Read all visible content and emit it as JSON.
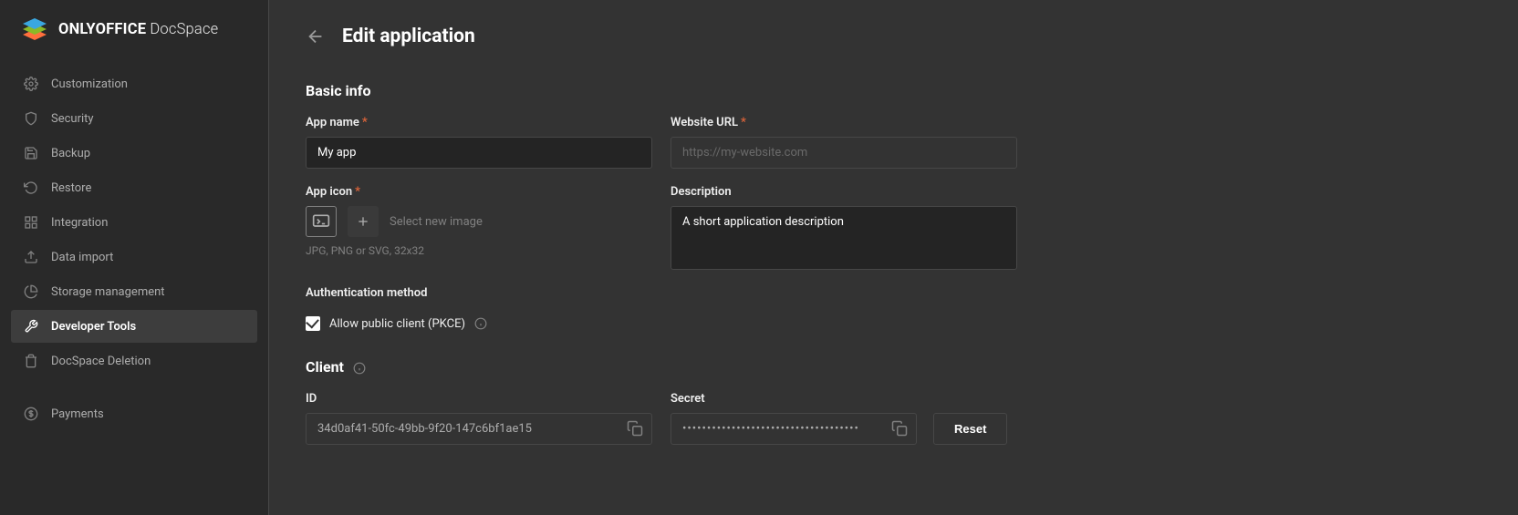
{
  "brand": {
    "bold": "ONLYOFFICE",
    "light": " DocSpace"
  },
  "sidebar": {
    "items": [
      {
        "label": "Customization"
      },
      {
        "label": "Security"
      },
      {
        "label": "Backup"
      },
      {
        "label": "Restore"
      },
      {
        "label": "Integration"
      },
      {
        "label": "Data import"
      },
      {
        "label": "Storage management"
      },
      {
        "label": "Developer Tools"
      },
      {
        "label": "DocSpace Deletion"
      }
    ],
    "payments": "Payments"
  },
  "header": {
    "title": "Edit application"
  },
  "basic": {
    "section": "Basic info",
    "app_name_label": "App name",
    "app_name_value": "My app",
    "website_label": "Website URL",
    "website_placeholder": "https://my-website.com",
    "app_icon_label": "App icon",
    "select_new": "Select new image",
    "icon_hint": "JPG, PNG or SVG, 32x32",
    "description_label": "Description",
    "description_value": "A short application description",
    "auth_label": "Authentication method",
    "pkce_label": "Allow public client (PKCE)"
  },
  "client": {
    "section": "Client",
    "id_label": "ID",
    "id_value": "34d0af41-50fc-49bb-9f20-147c6bf1ae15",
    "secret_label": "Secret",
    "secret_dots": "••••••••••••••••••••••••••••••••••••",
    "reset": "Reset"
  }
}
